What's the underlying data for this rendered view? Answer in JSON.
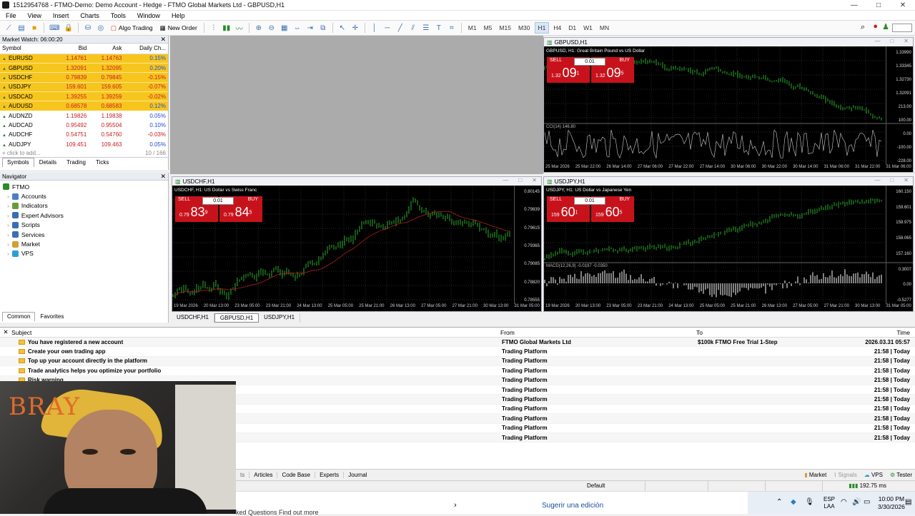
{
  "window": {
    "title": "1512954768 - FTMO-Demo: Demo Account - Hedge - FTMO Global Markets Ltd - GBPUSD,H1",
    "min": "—",
    "max": "□",
    "close": "✕"
  },
  "menu": [
    "File",
    "View",
    "Insert",
    "Charts",
    "Tools",
    "Window",
    "Help"
  ],
  "toolbar": {
    "algo": "Algo Trading",
    "neworder": "New Order",
    "timeframes": [
      "M1",
      "M5",
      "M15",
      "M30",
      "H1",
      "H4",
      "D1",
      "W1",
      "MN"
    ],
    "selected_tf": "H1"
  },
  "market_watch": {
    "title": "Market Watch: 06:00:20",
    "columns": [
      "Symbol",
      "Bid",
      "Ask",
      "Daily Ch..."
    ],
    "rows": [
      {
        "s": "EURUSD",
        "b": "1.14761",
        "a": "1.14763",
        "c": "0.15%",
        "hl": true
      },
      {
        "s": "GBPUSD",
        "b": "1.32091",
        "a": "1.32095",
        "c": "0.20%",
        "hl": true
      },
      {
        "s": "USDCHF",
        "b": "0.79839",
        "a": "0.79845",
        "c": "-0.15%",
        "hl": true
      },
      {
        "s": "USDJPY",
        "b": "159.601",
        "a": "159.605",
        "c": "-0.07%",
        "hl": true
      },
      {
        "s": "USDCAD",
        "b": "1.39255",
        "a": "1.39259",
        "c": "-0.02%",
        "hl": true
      },
      {
        "s": "AUDUSD",
        "b": "0.68578",
        "a": "0.68583",
        "c": "0.12%",
        "hl": true
      },
      {
        "s": "AUDNZD",
        "b": "1.19826",
        "a": "1.19838",
        "c": "0.05%",
        "hl": false
      },
      {
        "s": "AUDCAD",
        "b": "0.95492",
        "a": "0.95504",
        "c": "0.10%",
        "hl": false
      },
      {
        "s": "AUDCHF",
        "b": "0.54751",
        "a": "0.54760",
        "c": "-0.03%",
        "hl": false
      },
      {
        "s": "AUDJPY",
        "b": "109.451",
        "a": "109.463",
        "c": "0.05%",
        "hl": false
      }
    ],
    "add": "+ click to add...",
    "count": "10 / 166",
    "tabs": [
      "Symbols",
      "Details",
      "Trading",
      "Ticks"
    ]
  },
  "navigator": {
    "title": "Navigator",
    "root": "FTMO",
    "items": [
      "Accounts",
      "Indicators",
      "Expert Advisors",
      "Scripts",
      "Services",
      "Market",
      "VPS"
    ],
    "tabs": [
      "Common",
      "Favorites"
    ]
  },
  "charts": {
    "gbpusd": {
      "win": "GBPUSD,H1",
      "label": "GBPUSD, H1: Great Britain Pound vs US Dollar",
      "sell_big": "09",
      "sell_sup": "1",
      "sell_pre": "1.32",
      "buy_big": "09",
      "buy_sup": "5",
      "buy_pre": "1.32",
      "lot": "0.01",
      "sell": "SELL",
      "buy": "BUY",
      "ind": "CCI(14) 146.80",
      "y": [
        "1.33990",
        "1.33345",
        "1.32730",
        "1.32091",
        "213.00",
        "100.00",
        "0.00",
        "-100.00",
        "-228.00"
      ],
      "x": [
        "25 Mar 2026",
        "25 Mar 22:00",
        "26 Mar 14:00",
        "27 Mar 06:00",
        "27 Mar 22:00",
        "27 Mar 14:00",
        "30 Mar 06:00",
        "30 Mar 22:00",
        "30 Mar 14:00",
        "31 Mar 06:00",
        "31 Mar 22:00",
        "31 Mar 06:00"
      ]
    },
    "usdchf": {
      "win": "USDCHF,H1",
      "label": "USDCHF, H1: US Dollar vs Swiss Franc",
      "sell_big": "83",
      "sell_sup": "9",
      "sell_pre": "0.79",
      "buy_big": "84",
      "buy_sup": "5",
      "buy_pre": "0.79",
      "lot": "0.01",
      "sell": "SELL",
      "buy": "BUY",
      "y": [
        "0.80145",
        "0.79839",
        "0.79615",
        "0.79365",
        "0.79085",
        "0.78820",
        "0.78555"
      ],
      "x": [
        "19 Mar 2026",
        "20 Mar 13:00",
        "23 Mar 05:00",
        "23 Mar 21:00",
        "24 Mar 13:00",
        "25 Mar 05:00",
        "25 Mar 21:00",
        "26 Mar 13:00",
        "27 Mar 05:00",
        "27 Mar 21:00",
        "30 Mar 13:00",
        "31 Mar 05:00"
      ]
    },
    "usdjpy": {
      "win": "USDJPY,H1",
      "label": "USDJPY, H1: US Dollar vs Japanese Yen",
      "sell_big": "60",
      "sell_sup": "1",
      "sell_pre": "159",
      "buy_big": "60",
      "buy_sup": "5",
      "buy_pre": "159",
      "lot": "0.01",
      "sell": "SELL",
      "buy": "BUY",
      "ind": "MACD(12,26,9) -0.0197 -0.0350",
      "y": [
        "160.150",
        "159.601",
        "158.975",
        "158.065",
        "157.160",
        "0.3007",
        "0.00",
        "-0.5277"
      ],
      "x": [
        "19 Mar 2026",
        "20 Mar 13:00",
        "23 Mar 05:00",
        "23 Mar 21:00",
        "24 Mar 13:00",
        "25 Mar 05:00",
        "25 Mar 21:00",
        "26 Mar 13:00",
        "27 Mar 05:00",
        "27 Mar 21:00",
        "30 Mar 13:00",
        "31 Mar 05:00"
      ]
    }
  },
  "chart_tabs": [
    "USDCHF,H1",
    "GBPUSD,H1",
    "USDJPY,H1"
  ],
  "mailbox": {
    "cols": [
      "Subject",
      "From",
      "To",
      "Time"
    ],
    "rows": [
      {
        "sub": "You have registered a new account",
        "from": "FTMO Global Markets Ltd",
        "to": "$100k FTMO Free Trial 1-Step",
        "time": "2026.03.31 05:57"
      },
      {
        "sub": "Create your own trading app",
        "from": "Trading Platform",
        "to": "",
        "time": "21:58 | Today"
      },
      {
        "sub": "Top up your account directly in the platform",
        "from": "Trading Platform",
        "to": "",
        "time": "21:58 | Today"
      },
      {
        "sub": "Trade analytics helps you optimize your portfolio",
        "from": "Trading Platform",
        "to": "",
        "time": "21:58 | Today"
      },
      {
        "sub": "Risk warning",
        "from": "Trading Platform",
        "to": "",
        "time": "21:58 | Today"
      },
      {
        "sub": "",
        "from": "Trading Platform",
        "to": "",
        "time": "21:58 | Today"
      },
      {
        "sub": "",
        "from": "Trading Platform",
        "to": "",
        "time": "21:58 | Today"
      },
      {
        "sub": "",
        "from": "Trading Platform",
        "to": "",
        "time": "21:58 | Today"
      },
      {
        "sub": "",
        "from": "Trading Platform",
        "to": "",
        "time": "21:58 | Today"
      },
      {
        "sub": "",
        "from": "Trading Platform",
        "to": "",
        "time": "21:58 | Today"
      },
      {
        "sub": "",
        "from": "Trading Platform",
        "to": "",
        "time": "21:58 | Today"
      }
    ]
  },
  "bottom_tabs": [
    "Articles",
    "Code Base",
    "Experts",
    "Journal"
  ],
  "bottom_right": [
    "Market",
    "Signals",
    "VPS",
    "Tester"
  ],
  "status": {
    "profile": "Default",
    "ping": "192.75 ms"
  },
  "taskbar": {
    "banner": "ked Questions Find out more",
    "suggest": "Sugerir una edición",
    "lang": "ESP",
    "lang2": "LAA",
    "time": "10:00 PM",
    "date": "3/30/2026"
  },
  "webcam": {
    "overlay": "BRAY"
  }
}
